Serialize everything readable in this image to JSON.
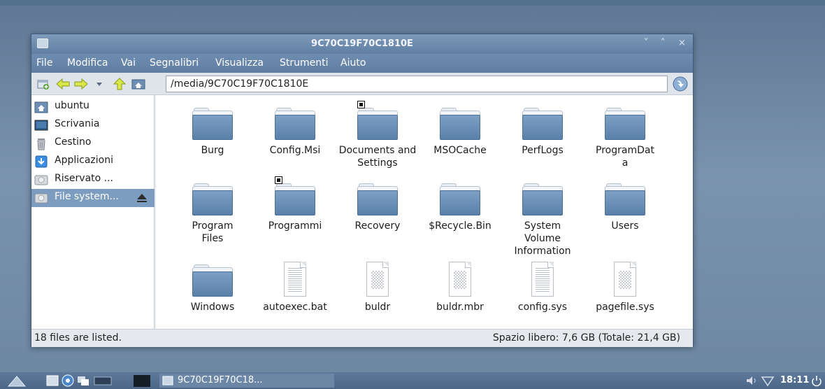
{
  "window": {
    "title": "9C70C19F70C1810E",
    "controls": [
      "˅",
      "˄",
      "×"
    ]
  },
  "menu": [
    "File",
    "Modifica",
    "Vai",
    "Segnalibri",
    "Visualizza",
    "Strumenti",
    "Aiuto"
  ],
  "toolbar": {
    "path": "/media/9C70C19F70C1810E"
  },
  "sidebar": {
    "items": [
      {
        "label": "ubuntu",
        "icon": "home-icon"
      },
      {
        "label": "Scrivania",
        "icon": "desktop-icon"
      },
      {
        "label": "Cestino",
        "icon": "trash-icon"
      },
      {
        "label": "Applicazioni",
        "icon": "applications-icon"
      },
      {
        "label": "Riservato ...",
        "icon": "drive-icon"
      },
      {
        "label": "File system...",
        "icon": "drive-icon",
        "selected": true
      }
    ]
  },
  "files": [
    {
      "name": "Burg",
      "type": "folder"
    },
    {
      "name": "Config.Msi",
      "type": "folder"
    },
    {
      "name": "Documents and Settings",
      "type": "folder",
      "link": true
    },
    {
      "name": "MSOCache",
      "type": "folder"
    },
    {
      "name": "PerfLogs",
      "type": "folder"
    },
    {
      "name": "ProgramData",
      "type": "folder"
    },
    {
      "name": "Program Files",
      "type": "folder"
    },
    {
      "name": "Programmi",
      "type": "folder",
      "link": true
    },
    {
      "name": "Recovery",
      "type": "folder"
    },
    {
      "name": "$Recycle.Bin",
      "type": "folder"
    },
    {
      "name": "System Volume Information",
      "type": "folder"
    },
    {
      "name": "Users",
      "type": "folder"
    },
    {
      "name": "Windows",
      "type": "folder"
    },
    {
      "name": "autoexec.bat",
      "type": "text"
    },
    {
      "name": "buldr",
      "type": "binary"
    },
    {
      "name": "buldr.mbr",
      "type": "binary"
    },
    {
      "name": "config.sys",
      "type": "text"
    },
    {
      "name": "pagefile.sys",
      "type": "binary"
    }
  ],
  "status": {
    "left": "18 files are listed.",
    "right": "Spazio libero: 7,6 GB (Totale: 21,4 GB)"
  },
  "taskbar": {
    "window_label": "9C70C19F70C18...",
    "time": "18:11"
  }
}
